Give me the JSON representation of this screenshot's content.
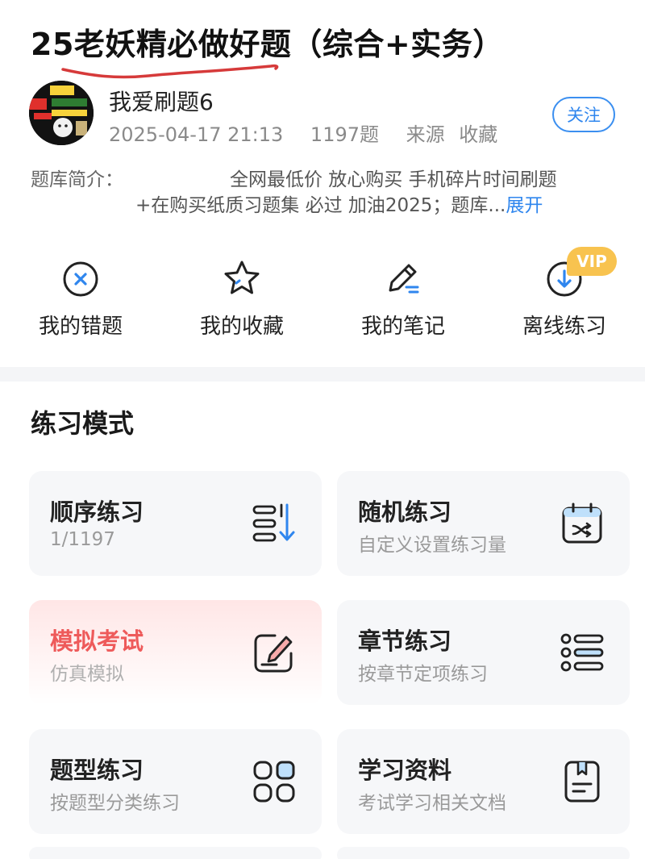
{
  "header": {
    "title": "25老妖精必做好题（综合+实务）",
    "author": "我爱刷题6",
    "date": "2025-04-17 21:13",
    "question_count": "1197题",
    "source_label": "来源",
    "collect_label": "收藏",
    "follow_label": "关注"
  },
  "intro": {
    "label": "题库简介：",
    "line1": "全网最低价 放心购买  手机碎片时间刷题",
    "line2": "+在购买纸质习题集 必过 加油2025；题库...",
    "expand_label": "展开"
  },
  "quick_actions": [
    {
      "label": "我的错题",
      "icon": "wrong-questions-icon"
    },
    {
      "label": "我的收藏",
      "icon": "star-icon"
    },
    {
      "label": "我的笔记",
      "icon": "pen-note-icon"
    },
    {
      "label": "离线练习",
      "icon": "download-icon"
    }
  ],
  "vip_badge": "VIP",
  "practice": {
    "section_title": "练习模式",
    "cards": [
      {
        "title": "顺序练习",
        "subtitle": "1/1197",
        "icon": "sequence-list-icon"
      },
      {
        "title": "随机练习",
        "subtitle": "自定义设置练习量",
        "icon": "shuffle-calendar-icon"
      },
      {
        "title": "模拟考试",
        "subtitle": "仿真模拟",
        "icon": "exam-edit-icon"
      },
      {
        "title": "章节练习",
        "subtitle": "按章节定项练习",
        "icon": "chapter-list-icon"
      },
      {
        "title": "题型练习",
        "subtitle": "按题型分类练习",
        "icon": "grid-icon"
      },
      {
        "title": "学习资料",
        "subtitle": "考试学习相关文档",
        "icon": "document-icon"
      }
    ]
  },
  "colors": {
    "accent": "#2f86ee",
    "exam_red": "#ee5a5a",
    "vip_gold": "#f8c34f",
    "handwriting_red": "#d63a3a",
    "card_bg": "#f6f7f9"
  }
}
